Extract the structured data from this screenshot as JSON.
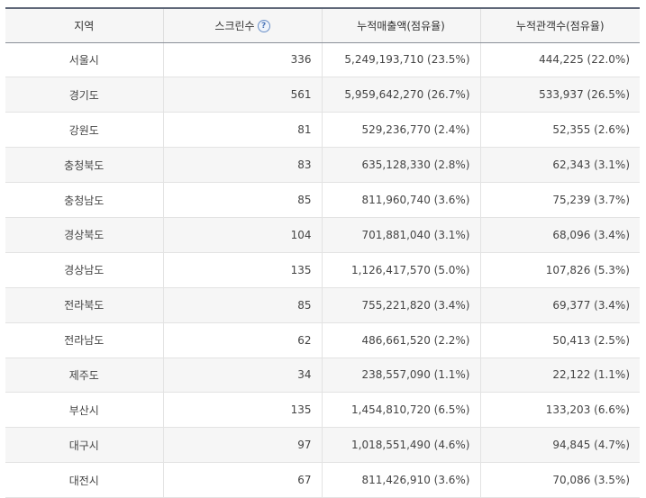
{
  "table": {
    "headers": {
      "region": "지역",
      "screens": "스크린수",
      "screens_help": "?",
      "sales": "누적매출액(점유율)",
      "audience": "누적관객수(점유율)"
    },
    "rows": [
      {
        "region": "서울시",
        "screens": "336",
        "sales": "5,249,193,710 (23.5%)",
        "audience": "444,225 (22.0%)"
      },
      {
        "region": "경기도",
        "screens": "561",
        "sales": "5,959,642,270 (26.7%)",
        "audience": "533,937 (26.5%)"
      },
      {
        "region": "강원도",
        "screens": "81",
        "sales": "529,236,770 (2.4%)",
        "audience": "52,355 (2.6%)"
      },
      {
        "region": "충청북도",
        "screens": "83",
        "sales": "635,128,330 (2.8%)",
        "audience": "62,343 (3.1%)"
      },
      {
        "region": "충청남도",
        "screens": "85",
        "sales": "811,960,740 (3.6%)",
        "audience": "75,239 (3.7%)"
      },
      {
        "region": "경상북도",
        "screens": "104",
        "sales": "701,881,040 (3.1%)",
        "audience": "68,096 (3.4%)"
      },
      {
        "region": "경상남도",
        "screens": "135",
        "sales": "1,126,417,570 (5.0%)",
        "audience": "107,826 (5.3%)"
      },
      {
        "region": "전라북도",
        "screens": "85",
        "sales": "755,221,820 (3.4%)",
        "audience": "69,377 (3.4%)"
      },
      {
        "region": "전라남도",
        "screens": "62",
        "sales": "486,661,520 (2.2%)",
        "audience": "50,413 (2.5%)"
      },
      {
        "region": "제주도",
        "screens": "34",
        "sales": "238,557,090 (1.1%)",
        "audience": "22,122 (1.1%)"
      },
      {
        "region": "부산시",
        "screens": "135",
        "sales": "1,454,810,720 (6.5%)",
        "audience": "133,203 (6.6%)"
      },
      {
        "region": "대구시",
        "screens": "97",
        "sales": "1,018,551,490 (4.6%)",
        "audience": "94,845 (4.7%)"
      },
      {
        "region": "대전시",
        "screens": "67",
        "sales": "811,426,910 (3.6%)",
        "audience": "70,086 (3.5%)"
      }
    ]
  }
}
